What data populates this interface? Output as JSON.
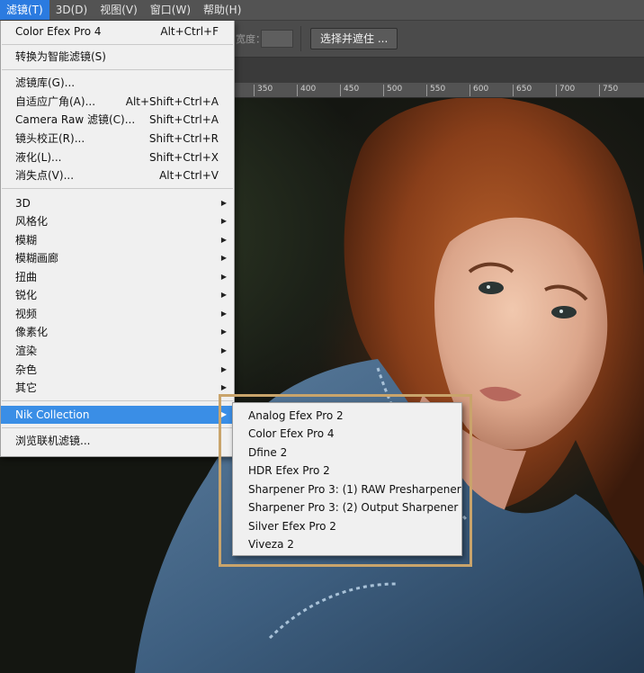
{
  "menubar": {
    "items": [
      {
        "label": "滤镜(T)",
        "active": true
      },
      {
        "label": "3D(D)"
      },
      {
        "label": "视图(V)"
      },
      {
        "label": "窗口(W)"
      },
      {
        "label": "帮助(H)"
      }
    ]
  },
  "options_bar": {
    "partial_label": "宽度：",
    "select_mask_button": "选择并遮住 ..."
  },
  "ruler": {
    "ticks": [
      "350",
      "400",
      "450",
      "500",
      "550",
      "600",
      "650",
      "700",
      "750"
    ]
  },
  "filter_menu": {
    "last_filter": {
      "label": "Color Efex Pro 4",
      "shortcut": "Alt+Ctrl+F"
    },
    "convert_smart": {
      "label": "转换为智能滤镜(S)"
    },
    "gallery_items": [
      {
        "label": "滤镜库(G)...",
        "shortcut": ""
      },
      {
        "label": "自适应广角(A)...",
        "shortcut": "Alt+Shift+Ctrl+A"
      },
      {
        "label": "Camera Raw 滤镜(C)...",
        "shortcut": "Shift+Ctrl+A"
      },
      {
        "label": "镜头校正(R)...",
        "shortcut": "Shift+Ctrl+R"
      },
      {
        "label": "液化(L)...",
        "shortcut": "Shift+Ctrl+X"
      },
      {
        "label": "消失点(V)...",
        "shortcut": "Alt+Ctrl+V"
      }
    ],
    "submenu_items": [
      {
        "label": "3D"
      },
      {
        "label": "风格化"
      },
      {
        "label": "模糊"
      },
      {
        "label": "模糊画廊"
      },
      {
        "label": "扭曲"
      },
      {
        "label": "锐化"
      },
      {
        "label": "视频"
      },
      {
        "label": "像素化"
      },
      {
        "label": "渲染"
      },
      {
        "label": "杂色"
      },
      {
        "label": "其它"
      }
    ],
    "nik": {
      "label": "Nik Collection"
    },
    "browse": {
      "label": "浏览联机滤镜..."
    },
    "arrow_glyph": "▶"
  },
  "nik_submenu": {
    "items": [
      {
        "label": "Analog Efex Pro 2"
      },
      {
        "label": "Color Efex Pro 4"
      },
      {
        "label": "Dfine 2"
      },
      {
        "label": "HDR Efex Pro 2"
      },
      {
        "label": "Sharpener Pro 3: (1) RAW Presharpener"
      },
      {
        "label": "Sharpener Pro 3: (2) Output Sharpener"
      },
      {
        "label": "Silver Efex Pro 2"
      },
      {
        "label": "Viveza 2"
      }
    ]
  },
  "colors": {
    "menu_highlight": "#3a8ee6",
    "callout_frame": "#c9a46b",
    "menubar_bg": "#535353"
  }
}
